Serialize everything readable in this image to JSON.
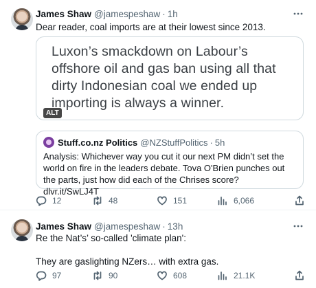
{
  "tweets": [
    {
      "author_name": "James Shaw",
      "author_handle": "@jamespeshaw",
      "separator": "·",
      "time": "1h",
      "text": "Dear reader, coal imports are at their lowest since 2013.",
      "media": {
        "text": "Luxon’s smackdown on Labour’s offshore oil and gas ban using all that dirty Indonesian coal we ended up importing is always a winner.",
        "alt_badge": "ALT"
      },
      "quote": {
        "author_name": "Stuff.co.nz Politics",
        "author_handle": "@NZStuffPolitics",
        "separator": "·",
        "time": "5h",
        "text": "Analysis: Whichever way you cut it our next PM didn’t set the world on fire in the leaders debate. Tova O'Brien punches out the parts, just how did each of the Chrises score? dlvr.it/SwLJ4T"
      },
      "stats": {
        "replies": "12",
        "retweets": "48",
        "likes": "151",
        "views": "6,066"
      }
    },
    {
      "author_name": "James Shaw",
      "author_handle": "@jamespeshaw",
      "separator": "·",
      "time": "13h",
      "text_line1": "Re the Nat’s’ so-called 'climate plan':",
      "text_line2": "They are gaslighting NZers… with extra gas.",
      "stats": {
        "replies": "97",
        "retweets": "90",
        "likes": "608",
        "views": "21.1K"
      }
    }
  ],
  "icons": {
    "more": "more-horizontal-icon",
    "reply": "reply-icon",
    "retweet": "retweet-icon",
    "like": "heart-icon",
    "views": "analytics-icon",
    "share": "share-icon"
  },
  "colors": {
    "text_primary": "#0f1419",
    "text_secondary": "#536471",
    "border": "#cfd9de",
    "divider": "#eff3f4"
  }
}
